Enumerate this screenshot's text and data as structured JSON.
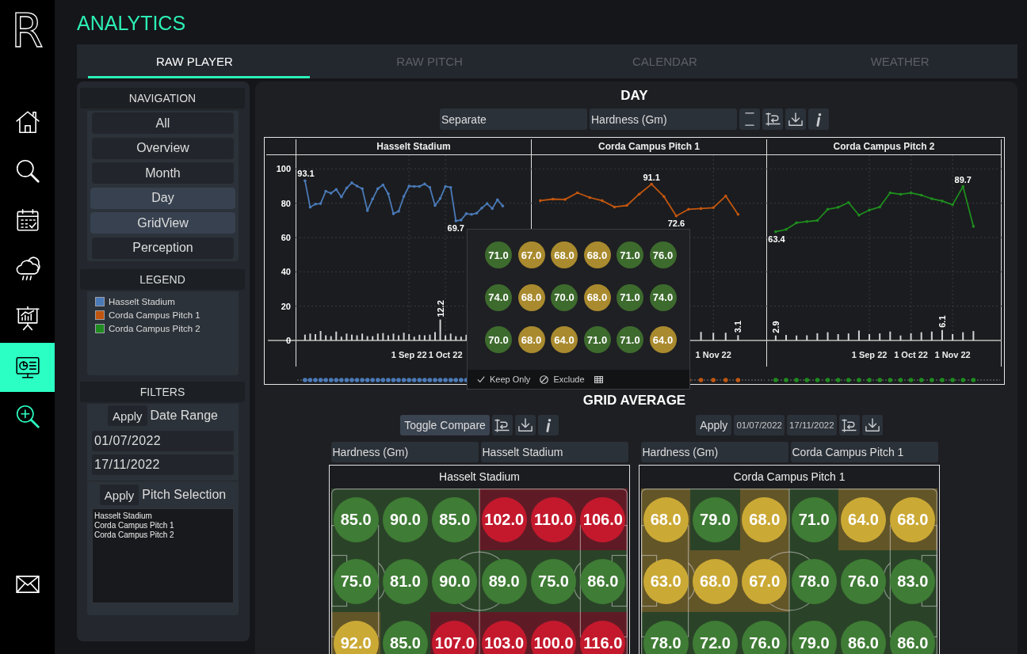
{
  "rail": {
    "logo": "R",
    "items": [
      {
        "kind": "home",
        "selected": false
      },
      {
        "kind": "search",
        "selected": false
      },
      {
        "kind": "calendar",
        "selected": false
      },
      {
        "kind": "weather",
        "selected": false
      },
      {
        "kind": "presentation",
        "selected": false
      },
      {
        "kind": "dashboard",
        "selected": true
      },
      {
        "kind": "zoom",
        "selected": false
      }
    ],
    "bottom_items": [
      {
        "kind": "mail",
        "selected": false
      }
    ]
  },
  "header": {
    "title": "ANALYTICS"
  },
  "tabs": [
    {
      "label": "RAW PLAYER",
      "selected": true
    },
    {
      "label": "RAW PITCH",
      "selected": false
    },
    {
      "label": "CALENDAR",
      "selected": false
    },
    {
      "label": "WEATHER",
      "selected": false
    }
  ],
  "sidebar": {
    "navigation": {
      "title": "NAVIGATION",
      "items": [
        {
          "label": "All",
          "selected": false
        },
        {
          "label": "Overview",
          "selected": false
        },
        {
          "label": "Month",
          "selected": false
        },
        {
          "label": "Day",
          "selected": true
        },
        {
          "label": "GridView",
          "selected": true
        },
        {
          "label": "Perception",
          "selected": false
        }
      ]
    },
    "legend": {
      "title": "LEGEND",
      "items": [
        {
          "label": "Hasselt Stadium",
          "color": "#4a7ab8"
        },
        {
          "label": "Corda Campus Pitch 1",
          "color": "#c2560f"
        },
        {
          "label": "Corda Campus Pitch 2",
          "color": "#1e8c1e"
        }
      ]
    },
    "filters": {
      "title": "FILTERS",
      "date_range": {
        "button": "Apply",
        "label": "Date Range",
        "fields": [
          {
            "value": "01/07/2022"
          },
          {
            "value": "17/11/2022"
          }
        ]
      },
      "pitch_selection": {
        "button": "Apply",
        "label": "Pitch Selection",
        "options": [
          {
            "label": "Hasselt Stadium",
            "selected": false
          },
          {
            "label": "Corda Campus Pitch 1",
            "selected": false
          },
          {
            "label": "Corda Campus Pitch 2",
            "selected": false
          }
        ]
      }
    }
  },
  "day": {
    "title": "DAY",
    "toolbar": [
      {
        "kind": "dropdown",
        "value": "Separate"
      },
      {
        "kind": "dropdown",
        "value": "Hardness (Gm)"
      },
      {
        "kind": "bounds"
      },
      {
        "kind": "axis"
      },
      {
        "kind": "download"
      },
      {
        "kind": "info"
      }
    ],
    "facets": [
      {
        "chart_data": {
          "type": "line",
          "title": "Hasselt Stadium",
          "grid": true,
          "categories": [
            null,
            null,
            null,
            null,
            null,
            null,
            null,
            null,
            null,
            null,
            null,
            null,
            null,
            null,
            null,
            null,
            null,
            null,
            null,
            null,
            "1 Sep 22",
            null,
            null,
            null,
            null,
            null,
            null,
            "1 Oct 22",
            null,
            null,
            null,
            null,
            null,
            null,
            null,
            null,
            null,
            null,
            null
          ],
          "series": [
            {
              "color": "#4a7ab8",
              "values": [
                93.1,
                77.7,
                79.5,
                79.8,
                87.0,
                85.8,
                88.0,
                83.7,
                88.8,
                91.9,
                90.0,
                88.5,
                75.7,
                82.5,
                88.5,
                90.7,
                85.5,
                73.9,
                75.3,
                84.0,
                90.0,
                89.8,
                89.8,
                91.2,
                89.2,
                78.7,
                82.8,
                89.8,
                89.2,
                69.7,
                70.2,
                73.9,
                73.5,
                74.2,
                77.2,
                79.8,
                76.9,
                82.0,
                78.4
              ]
            },
            {
              "type": "bar",
              "color": "#d2d2d2",
              "values": [
                3.4,
                4.0,
                3.7,
                5.5,
                3.0,
                2.5,
                5.2,
                2.2,
                4.0,
                3.4,
                3.0,
                4.0,
                2.5,
                2.5,
                4.0,
                4.3,
                3.0,
                4.0,
                3.0,
                4.5,
                3.7,
                2.2,
                3.3,
                3.0,
                3.4,
                4.9,
                12.2,
                3.0,
                4.0,
                2.5,
                2.2,
                3.3,
                null,
                null,
                null,
                null,
                null,
                null,
                null
              ]
            }
          ],
          "ylim": [
            0,
            108
          ],
          "yticks": [
            0,
            20,
            40,
            60,
            80,
            100
          ],
          "annotations": [
            {
              "y": 93.1,
              "text": "93.1"
            },
            {
              "y": 69.7,
              "text": "69.7"
            },
            {
              "y": 12.2,
              "text": "12.2"
            }
          ]
        }
      },
      {
        "title": "Corda Campus Pitch 1",
        "color": "#c2560f",
        "x_labels": [
          "1 Nov 22"
        ],
        "value_labels": [
          "91.1",
          "72.6",
          "3.1"
        ]
      },
      {
        "title": "Corda Campus Pitch 2",
        "color": "#1e8c1e",
        "x_labels": [
          "1 Sep 22",
          "1 Oct 22",
          "1 Nov 22"
        ],
        "value_labels": [
          "63.4",
          "89.7",
          "2.9",
          "6.1"
        ]
      }
    ],
    "tooltip": {
      "rows": [
        [
          {
            "value": "71.0",
            "color": "#3d6b2e"
          },
          {
            "value": "67.0",
            "color": "#a98a2e"
          },
          {
            "value": "68.0",
            "color": "#a98a2e"
          },
          {
            "value": "68.0",
            "color": "#a98a2e"
          },
          {
            "value": "71.0",
            "color": "#3d6b2e"
          },
          {
            "value": "76.0",
            "color": "#3d6b2e"
          }
        ],
        [
          {
            "value": "74.0",
            "color": "#3d6b2e"
          },
          {
            "value": "68.0",
            "color": "#a98a2e"
          },
          {
            "value": "70.0",
            "color": "#3d6b2e"
          },
          {
            "value": "68.0",
            "color": "#a98a2e"
          },
          {
            "value": "71.0",
            "color": "#3d6b2e"
          },
          {
            "value": "74.0",
            "color": "#3d6b2e"
          }
        ],
        [
          {
            "value": "70.0",
            "color": "#3d6b2e"
          },
          {
            "value": "68.0",
            "color": "#a98a2e"
          },
          {
            "value": "64.0",
            "color": "#a98a2e"
          },
          {
            "value": "71.0",
            "color": "#3d6b2e"
          },
          {
            "value": "71.0",
            "color": "#3d6b2e"
          },
          {
            "value": "64.0",
            "color": "#a98a2e"
          }
        ]
      ],
      "actions": [
        {
          "kind": "keep",
          "label": "Keep Only"
        },
        {
          "kind": "exclude",
          "label": "Exclude"
        },
        {
          "kind": "table"
        }
      ]
    }
  },
  "grid_average": {
    "title": "GRID AVERAGE",
    "panels": [
      {
        "toolbar": [
          {
            "kind": "button",
            "label": "Toggle Compare",
            "on": true
          },
          {
            "kind": "axis"
          },
          {
            "kind": "download"
          },
          {
            "kind": "info"
          }
        ],
        "dropdowns": [
          "Hardness (Gm)",
          "Hasselt Stadium"
        ],
        "title": "Hasselt Stadium",
        "rows": [
          [
            {
              "value": "85.0",
              "color": "#3f7c35"
            },
            {
              "value": "90.0",
              "color": "#3f7c35"
            },
            {
              "value": "85.0",
              "color": "#3f7c35"
            },
            {
              "value": "102.0",
              "color": "#c4192d"
            },
            {
              "value": "110.0",
              "color": "#c4192d"
            },
            {
              "value": "106.0",
              "color": "#c4192d"
            }
          ],
          [
            {
              "value": "75.0",
              "color": "#3f7c35"
            },
            {
              "value": "81.0",
              "color": "#3f7c35"
            },
            {
              "value": "90.0",
              "color": "#3f7c35"
            },
            {
              "value": "89.0",
              "color": "#3f7c35"
            },
            {
              "value": "75.0",
              "color": "#3f7c35"
            },
            {
              "value": "86.0",
              "color": "#3f7c35"
            }
          ],
          [
            {
              "value": "92.0",
              "color": "#cba935"
            },
            {
              "value": "85.0",
              "color": "#3f7c35"
            },
            {
              "value": "107.0",
              "color": "#c4192d"
            },
            {
              "value": "103.0",
              "color": "#c4192d"
            },
            {
              "value": "100.0",
              "color": "#c4192d"
            },
            {
              "value": "116.0",
              "color": "#c4192d"
            }
          ]
        ]
      },
      {
        "toolbar": [
          {
            "kind": "button",
            "label": "Apply",
            "on": false
          },
          {
            "kind": "date",
            "value": "01/07/2022"
          },
          {
            "kind": "date",
            "value": "17/11/2022"
          },
          {
            "kind": "axis"
          },
          {
            "kind": "download"
          }
        ],
        "dropdowns": [
          "Hardness (Gm)",
          "Corda Campus Pitch 1"
        ],
        "title": "Corda Campus Pitch 1",
        "rows": [
          [
            {
              "value": "68.0",
              "color": "#cba935"
            },
            {
              "value": "79.0",
              "color": "#3f7c35"
            },
            {
              "value": "68.0",
              "color": "#cba935"
            },
            {
              "value": "71.0",
              "color": "#3f7c35"
            },
            {
              "value": "64.0",
              "color": "#cba935"
            },
            {
              "value": "68.0",
              "color": "#cba935"
            }
          ],
          [
            {
              "value": "63.0",
              "color": "#cba935"
            },
            {
              "value": "68.0",
              "color": "#cba935"
            },
            {
              "value": "67.0",
              "color": "#cba935"
            },
            {
              "value": "78.0",
              "color": "#3f7c35"
            },
            {
              "value": "76.0",
              "color": "#3f7c35"
            },
            {
              "value": "83.0",
              "color": "#3f7c35"
            }
          ],
          [
            {
              "value": "78.0",
              "color": "#3f7c35"
            },
            {
              "value": "72.0",
              "color": "#3f7c35"
            },
            {
              "value": "76.0",
              "color": "#3f7c35"
            },
            {
              "value": "79.0",
              "color": "#3f7c35"
            },
            {
              "value": "86.0",
              "color": "#3f7c35"
            },
            {
              "value": "86.0",
              "color": "#3f7c35"
            }
          ]
        ]
      }
    ]
  }
}
